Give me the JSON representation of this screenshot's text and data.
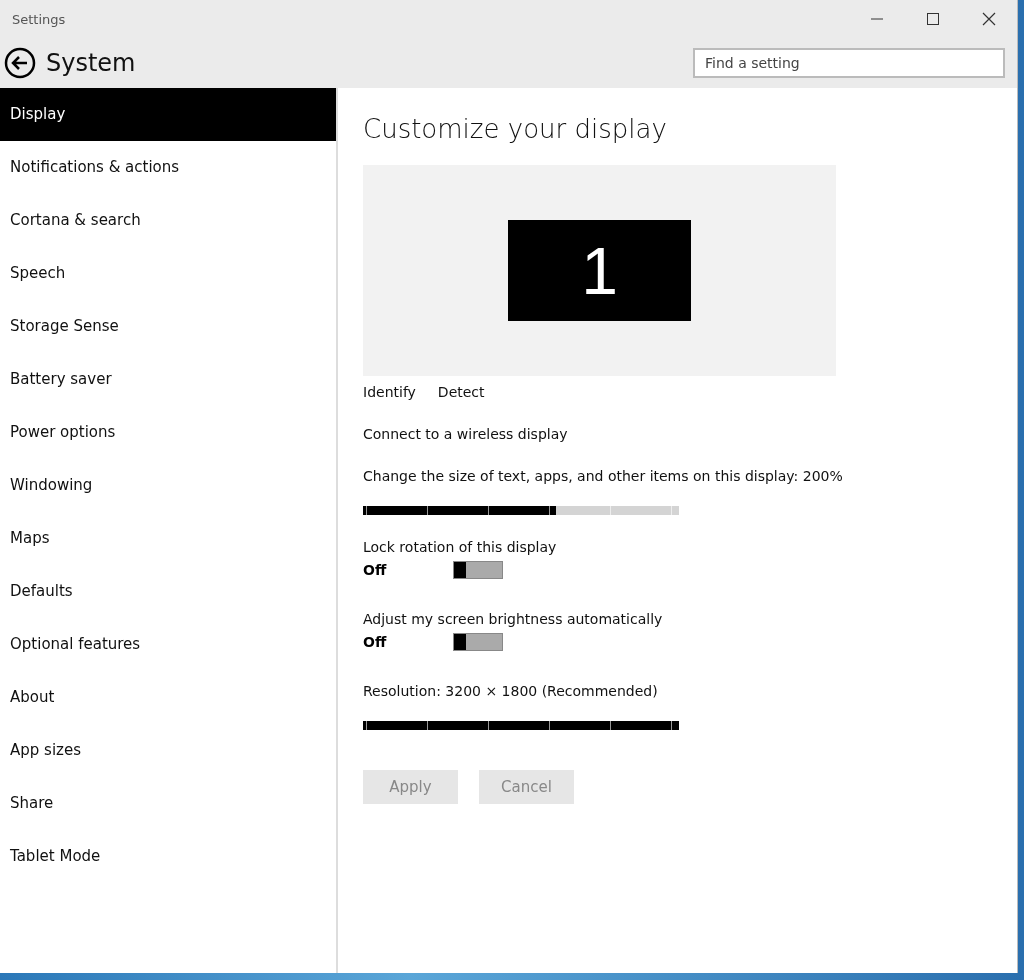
{
  "window": {
    "title": "Settings"
  },
  "header": {
    "title": "System",
    "search": {
      "placeholder": "Find a setting"
    }
  },
  "sidebar": {
    "items": [
      {
        "label": "Display",
        "selected": true
      },
      {
        "label": "Notifications & actions",
        "selected": false
      },
      {
        "label": "Cortana & search",
        "selected": false
      },
      {
        "label": "Speech",
        "selected": false
      },
      {
        "label": "Storage Sense",
        "selected": false
      },
      {
        "label": "Battery saver",
        "selected": false
      },
      {
        "label": "Power options",
        "selected": false
      },
      {
        "label": "Windowing",
        "selected": false
      },
      {
        "label": "Maps",
        "selected": false
      },
      {
        "label": "Defaults",
        "selected": false
      },
      {
        "label": "Optional features",
        "selected": false
      },
      {
        "label": "About",
        "selected": false
      },
      {
        "label": "App sizes",
        "selected": false
      },
      {
        "label": "Share",
        "selected": false
      },
      {
        "label": "Tablet Mode",
        "selected": false
      }
    ]
  },
  "content": {
    "heading": "Customize your display",
    "monitor": {
      "number": "1"
    },
    "links": [
      "Identify",
      "Detect"
    ],
    "wireless_link": "Connect to a wireless display",
    "settings": [
      {
        "kind": "slider",
        "label": "Change the size of text, apps, and other items on this display: 200%",
        "level": 0.61
      },
      {
        "kind": "toggle",
        "label": "Lock rotation of this display",
        "state_text": "Off",
        "on": false
      },
      {
        "kind": "toggle",
        "label": "Adjust my screen brightness automatically",
        "state_text": "Off",
        "on": false
      },
      {
        "kind": "slider",
        "label": "Resolution: 3200 × 1800 (Recommended)",
        "level": 1
      }
    ],
    "buttons": [
      {
        "label": "Apply",
        "disabled": true
      },
      {
        "label": "Cancel",
        "disabled": true
      }
    ]
  }
}
